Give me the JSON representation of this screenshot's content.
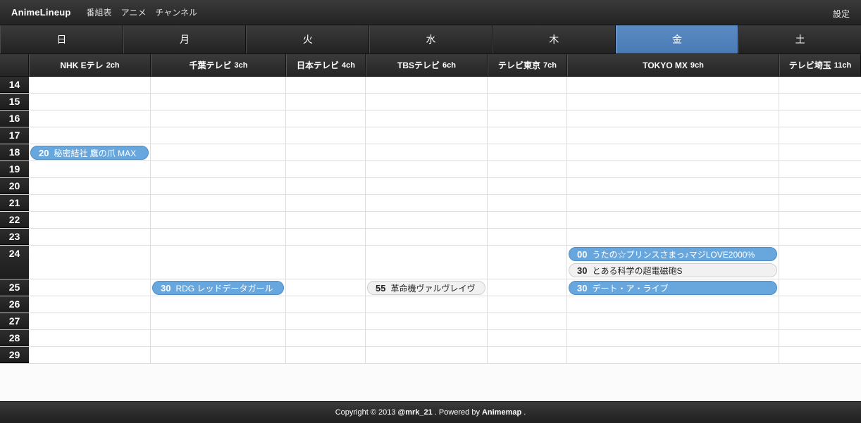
{
  "nav": {
    "brand": "AnimeLineup",
    "links": [
      "番組表",
      "アニメ",
      "チャンネル"
    ],
    "settings": "設定"
  },
  "days": [
    "日",
    "月",
    "火",
    "水",
    "木",
    "金",
    "土"
  ],
  "active_day": "金",
  "channels": [
    {
      "name": "NHK Eテレ",
      "ch": "2ch"
    },
    {
      "name": "千葉テレビ",
      "ch": "3ch"
    },
    {
      "name": "日本テレビ",
      "ch": "4ch"
    },
    {
      "name": "TBSテレビ",
      "ch": "6ch"
    },
    {
      "name": "テレビ東京",
      "ch": "7ch"
    },
    {
      "name": "TOKYO MX",
      "ch": "9ch"
    },
    {
      "name": "テレビ埼玉",
      "ch": "11ch"
    }
  ],
  "hours": [
    "14",
    "15",
    "16",
    "17",
    "18",
    "19",
    "20",
    "21",
    "22",
    "23",
    "24",
    "25",
    "26",
    "27",
    "28",
    "29"
  ],
  "programs": [
    {
      "hour": "18",
      "channel": 0,
      "minute": "20",
      "title": "秘密結社 鷹の爪 MAX",
      "style": "blue",
      "slot": 0
    },
    {
      "hour": "24",
      "channel": 5,
      "minute": "00",
      "title": "うたの☆プリンスさまっ♪マジLOVE2000%",
      "style": "blue",
      "slot": 0
    },
    {
      "hour": "24",
      "channel": 5,
      "minute": "30",
      "title": "とある科学の超電磁砲S",
      "style": "gray",
      "slot": 1
    },
    {
      "hour": "25",
      "channel": 1,
      "minute": "30",
      "title": "RDG レッドデータガール",
      "style": "blue",
      "slot": 0
    },
    {
      "hour": "25",
      "channel": 3,
      "minute": "55",
      "title": "革命機ヴァルヴレイヴ",
      "style": "gray",
      "slot": 0
    },
    {
      "hour": "25",
      "channel": 5,
      "minute": "30",
      "title": "デート・ア・ライブ",
      "style": "blue",
      "slot": 0
    }
  ],
  "footer": {
    "copyright": "Copyright © 2013",
    "author": "@mrk_21",
    "powered": ". Powered by",
    "site": "Animemap",
    "end": "."
  },
  "colors": {
    "active_tab": "#5c8bc3",
    "program_blue": "#67a7de",
    "program_gray": "#f1f1f1"
  }
}
